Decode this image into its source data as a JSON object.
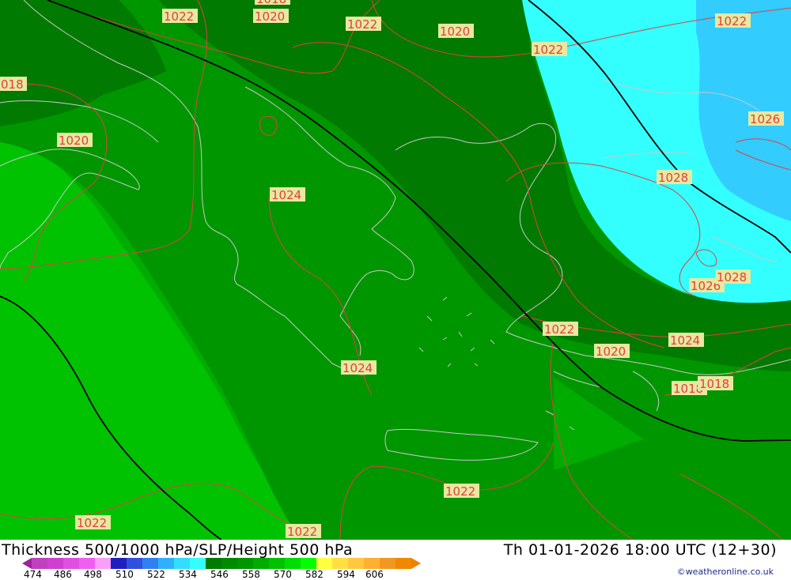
{
  "map": {
    "region": "Eastern Mediterranean / Greece / Aegean",
    "fill_colors": {
      "dark_green": "#007a00",
      "mid_green": "#009600",
      "green": "#00ac00",
      "light_green": "#00c200",
      "cyan": "#33ffff",
      "sky_blue": "#33ccff"
    },
    "coastline_color": "#c8c8c8",
    "isobar_color": "#e04040",
    "height_line_color": "#000000",
    "isobar_labels": [
      {
        "text": "1022"
      },
      {
        "text": "1020"
      },
      {
        "text": "1022"
      },
      {
        "text": "1020"
      },
      {
        "text": "1022"
      },
      {
        "text": "1022"
      },
      {
        "text": "018"
      },
      {
        "text": "1020"
      },
      {
        "text": "1026"
      },
      {
        "text": "1028"
      },
      {
        "text": "1024"
      },
      {
        "text": "1026"
      },
      {
        "text": "1028"
      },
      {
        "text": "1022"
      },
      {
        "text": "1024"
      },
      {
        "text": "1020"
      },
      {
        "text": "1024"
      },
      {
        "text": "1018"
      },
      {
        "text": "1018"
      },
      {
        "text": "1022"
      },
      {
        "text": "1022"
      },
      {
        "text": "1022"
      },
      {
        "text": "1018"
      }
    ]
  },
  "footer": {
    "title": "Thickness 500/1000 hPa/SLP/Height 500 hPa",
    "datetime": "Th 01-01-2026 18:00 UTC (12+30)",
    "credit": "©weatheronline.co.uk",
    "scale_ticks": [
      "474",
      "486",
      "498",
      "510",
      "522",
      "534",
      "546",
      "558",
      "570",
      "582",
      "594",
      "606"
    ],
    "scale_colors": [
      "#c040c0",
      "#d040d0",
      "#e050e0",
      "#f060f0",
      "#f8a0f8",
      "#2020c0",
      "#3050e0",
      "#3080f0",
      "#30b0f8",
      "#33ddff",
      "#33ffff",
      "#007a00",
      "#008a00",
      "#009600",
      "#00ac00",
      "#00c200",
      "#00dd00",
      "#00ff00",
      "#ffff40",
      "#ffe040",
      "#ffc840",
      "#ffb030",
      "#f09820",
      "#f08800"
    ]
  }
}
